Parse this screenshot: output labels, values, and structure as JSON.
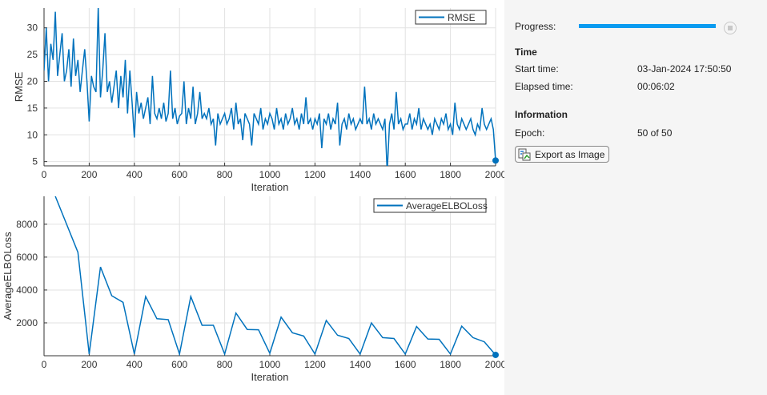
{
  "panel": {
    "progress_label": "Progress:",
    "progress_fraction": 1.0,
    "time_heading": "Time",
    "start_time_label": "Start time:",
    "start_time_value": "03-Jan-2024 17:50:50",
    "elapsed_time_label": "Elapsed time:",
    "elapsed_time_value": "00:06:02",
    "information_heading": "Information",
    "epoch_label": "Epoch:",
    "epoch_value": "50 of 50",
    "export_label": "Export as Image"
  },
  "colors": {
    "line": "#0072bd",
    "progress": "#0a9bf0"
  },
  "chart_data": [
    {
      "type": "line",
      "title": "",
      "xlabel": "Iteration",
      "ylabel": "RMSE",
      "legend": [
        "RMSE"
      ],
      "legend_position": "top-right",
      "grid": true,
      "xlim": [
        0,
        2000
      ],
      "ylim": [
        4.2,
        33.7
      ],
      "xticks": [
        0,
        200,
        400,
        600,
        800,
        1000,
        1200,
        1400,
        1600,
        1800,
        2000
      ],
      "yticks": [
        5,
        10,
        15,
        20,
        25,
        30
      ],
      "x_step": 10,
      "values": [
        22,
        30,
        20,
        27,
        24,
        33,
        21,
        25,
        29,
        20,
        22,
        26,
        19,
        28,
        21,
        24,
        18,
        22,
        26,
        20,
        12.5,
        21,
        19,
        18,
        34,
        17,
        22,
        29,
        18,
        20,
        16,
        19,
        22,
        15,
        21,
        17,
        24,
        14,
        22,
        16,
        9.5,
        18,
        14,
        16,
        13,
        15,
        17,
        12,
        21,
        14,
        13,
        15,
        13,
        16,
        12.5,
        14,
        22,
        13,
        15,
        12,
        13.5,
        14,
        20,
        12,
        15,
        13,
        19,
        12,
        14,
        18,
        13,
        14,
        13,
        15,
        12,
        13,
        8,
        14,
        12,
        13,
        14,
        12,
        13,
        15,
        11,
        16,
        12,
        13,
        9,
        14,
        13,
        12,
        8,
        14,
        13,
        12,
        15,
        11,
        13,
        12,
        14,
        13,
        11,
        15,
        12,
        13,
        11,
        14,
        12,
        13,
        15,
        12,
        13,
        11,
        14,
        12,
        17,
        12,
        13,
        11,
        13,
        12,
        14,
        7.5,
        13,
        12,
        14,
        11,
        13,
        12,
        16,
        8,
        12,
        13,
        11,
        14,
        12,
        13,
        11,
        12,
        13,
        12,
        19,
        12,
        13,
        11,
        14,
        12,
        13,
        12,
        11,
        13,
        3,
        12,
        14,
        11,
        18,
        12,
        13,
        11,
        12,
        12,
        14,
        11,
        13,
        12,
        15,
        11,
        13,
        12,
        11,
        12,
        10,
        13,
        12,
        11,
        13,
        12,
        14,
        11,
        12,
        10,
        16,
        12,
        11,
        13,
        12,
        11,
        12,
        13,
        11,
        10,
        12,
        11,
        15,
        12,
        11,
        12,
        13,
        11,
        5.2
      ]
    },
    {
      "type": "line",
      "title": "",
      "xlabel": "Iteration",
      "ylabel": "AverageELBOLoss",
      "legend": [
        "AverageELBOLoss"
      ],
      "legend_position": "top-right",
      "grid": true,
      "xlim": [
        0,
        2000
      ],
      "ylim": [
        0,
        9700
      ],
      "xticks": [
        0,
        200,
        400,
        600,
        800,
        1000,
        1200,
        1400,
        1600,
        1800,
        2000
      ],
      "yticks": [
        2000,
        4000,
        6000,
        8000
      ],
      "x": [
        50,
        100,
        150,
        200,
        250,
        300,
        350,
        400,
        450,
        500,
        550,
        600,
        650,
        700,
        750,
        800,
        850,
        900,
        950,
        1000,
        1050,
        1100,
        1150,
        1200,
        1250,
        1300,
        1350,
        1400,
        1450,
        1500,
        1550,
        1600,
        1650,
        1700,
        1750,
        1800,
        1850,
        1900,
        1950,
        2000
      ],
      "values": [
        9700,
        8000,
        6300,
        100,
        5400,
        3650,
        3250,
        100,
        3600,
        2250,
        2200,
        100,
        3600,
        1850,
        1850,
        100,
        2600,
        1600,
        1580,
        150,
        2350,
        1400,
        1200,
        100,
        2150,
        1250,
        1050,
        100,
        2000,
        1100,
        1050,
        100,
        1780,
        1020,
        1000,
        100,
        1800,
        1100,
        850,
        50
      ]
    }
  ]
}
